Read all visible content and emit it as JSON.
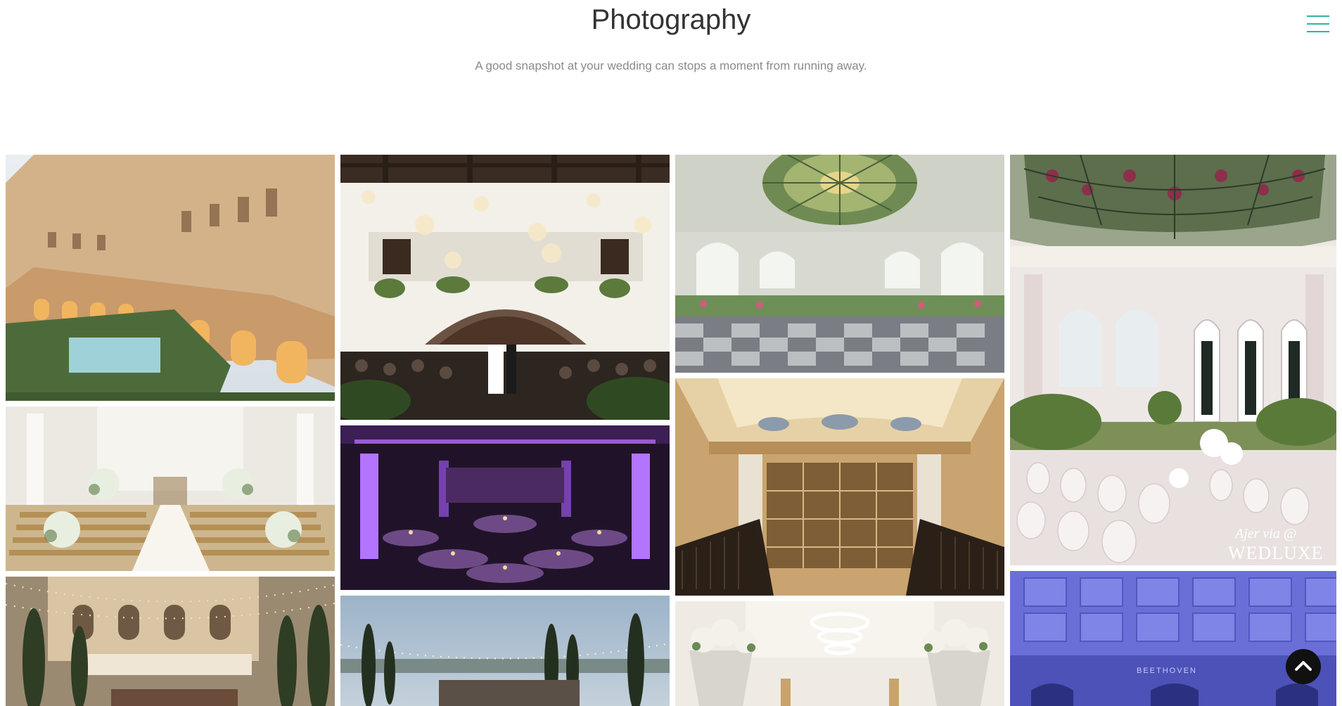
{
  "header": {
    "title": "Photography",
    "subtitle": "A good snapshot at your wedding can stops a moment from running away.",
    "menu_icon": "hamburger-menu-icon"
  },
  "gallery": {
    "photos": [
      {
        "name": "photo-courtyard-ceremony"
      },
      {
        "name": "photo-chapel-aisle"
      },
      {
        "name": "photo-garden-string-lights"
      },
      {
        "name": "photo-atrium-ceremony"
      },
      {
        "name": "photo-purple-ballroom"
      },
      {
        "name": "photo-terrace-dusk"
      },
      {
        "name": "photo-stained-glass-dome-hall"
      },
      {
        "name": "photo-ornate-ceiling-staircase"
      },
      {
        "name": "photo-white-hall-flowers"
      },
      {
        "name": "photo-conservatory-ceremony"
      },
      {
        "name": "photo-blue-ceiling-hall"
      }
    ],
    "watermark": {
      "script": "Ajer via @",
      "brand": "WEDLUXE"
    },
    "engraving": "BEETHOVEN"
  },
  "scroll_top": {
    "icon": "chevron-up-icon"
  },
  "colors": {
    "accent": "#2bb5a6",
    "title": "#333333",
    "subtitle": "#8a8a8a"
  }
}
